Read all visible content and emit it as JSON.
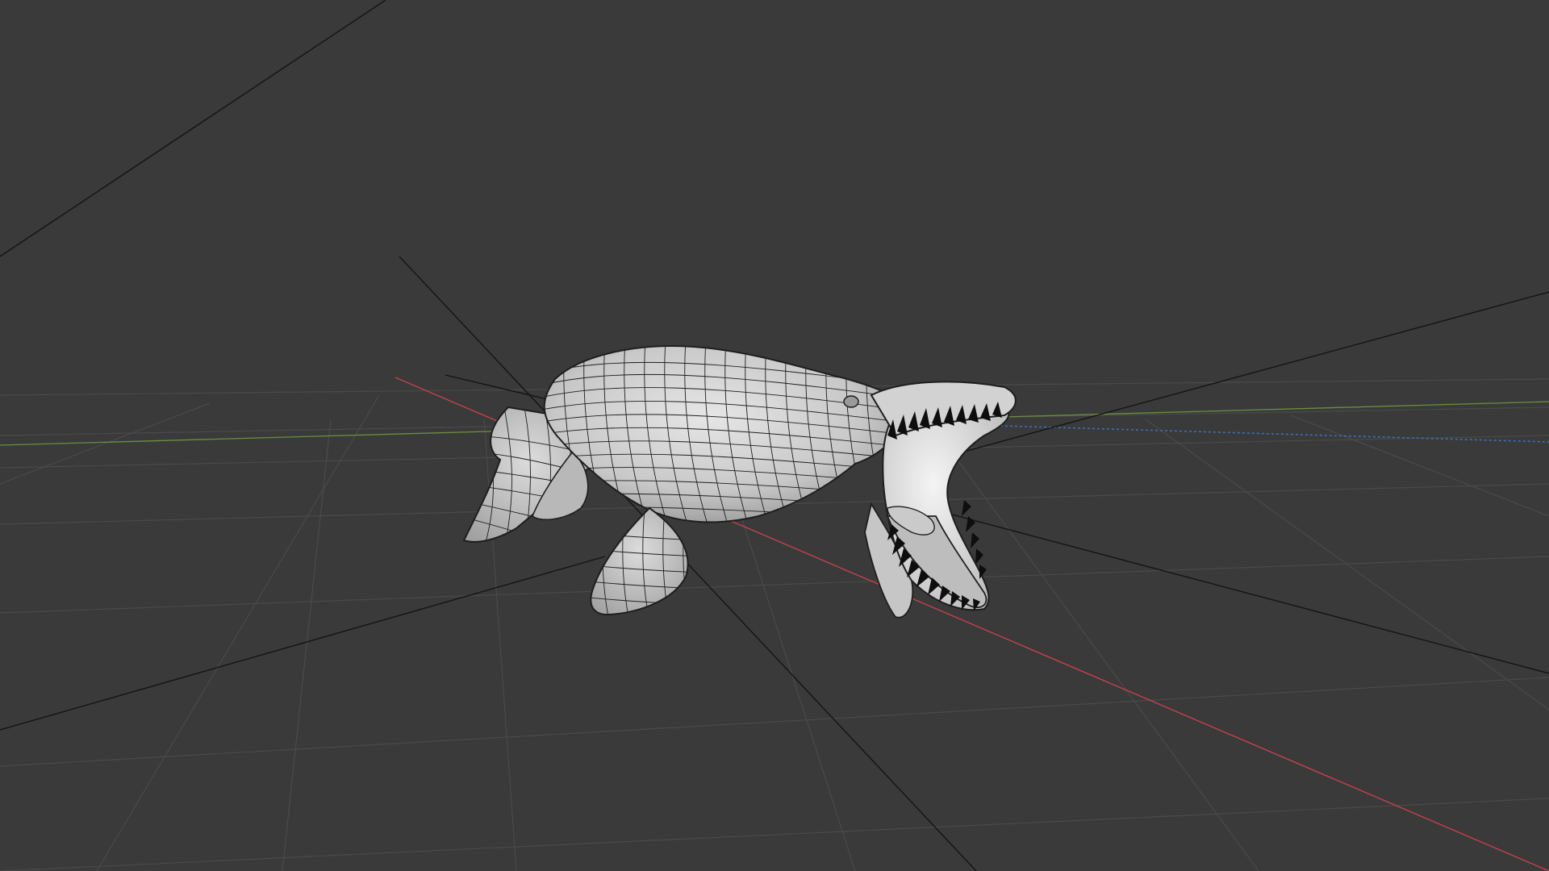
{
  "viewport": {
    "background_color": "#3a3a3a",
    "grid_color": "#4a4a4a",
    "x_axis_color": "#c4424a",
    "y_axis_color": "#6a8f3c",
    "z_axis_color": "#3d6fb5",
    "helper_line_color": "#141414",
    "object": {
      "name": "mosasaurus",
      "shading": "solid-wireframe",
      "surface_color": "#cfcfcf",
      "wire_color": "#1e1e1e",
      "teeth_color": "#0e0e0e"
    }
  }
}
